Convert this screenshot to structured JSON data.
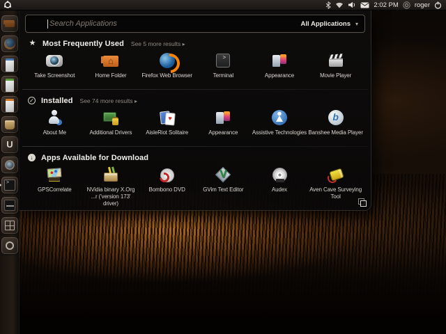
{
  "panel": {
    "logo_icon": "ubuntu-logo-icon",
    "time": "2:02 PM",
    "username": "roger",
    "indicator_icons": [
      "bluetooth-icon",
      "network-wifi-icon",
      "volume-icon",
      "mail-icon",
      "user-menu-icon",
      "power-icon"
    ]
  },
  "dash": {
    "search": {
      "value": "",
      "placeholder": "Search Applications",
      "filter_label": "All Applications",
      "filter_icon": "chevron-down-icon",
      "chevron_glyph": "▾"
    },
    "sections": [
      {
        "title": "Most Frequently Used",
        "icon": "star-icon",
        "icon_glyph": "★",
        "see_more": "See 5 more results",
        "see_more_arrow": "▸",
        "apps": [
          {
            "label": "Take Screenshot",
            "icon": "camera-icon"
          },
          {
            "label": "Home Folder",
            "icon": "home-folder-icon"
          },
          {
            "label": "Firefox Web Browser",
            "icon": "firefox-icon"
          },
          {
            "label": "Terminal",
            "icon": "terminal-icon"
          },
          {
            "label": "Appearance",
            "icon": "appearance-icon"
          },
          {
            "label": "Movie Player",
            "icon": "movie-clapper-icon"
          }
        ]
      },
      {
        "title": "Installed",
        "icon": "installed-check-icon",
        "icon_glyph": "✓",
        "see_more": "See 74 more results",
        "see_more_arrow": "▸",
        "apps": [
          {
            "label": "About Me",
            "icon": "about-me-icon"
          },
          {
            "label": "Additional Drivers",
            "icon": "drivers-board-icon"
          },
          {
            "label": "AisleRiot Solitaire",
            "icon": "solitaire-cards-icon"
          },
          {
            "label": "Appearance",
            "icon": "appearance-icon"
          },
          {
            "label": "Assistive Technologies",
            "icon": "accessibility-icon"
          },
          {
            "label": "Banshee Media Player",
            "icon": "banshee-icon"
          }
        ]
      },
      {
        "title": "Apps Available for Download",
        "icon": "download-circle-icon",
        "icon_glyph": "↓",
        "see_more": "",
        "see_more_arrow": "",
        "apps": [
          {
            "label": "GPSCorrelate",
            "icon": "gps-map-icon"
          },
          {
            "label": "NVidia binary X.Org\n...r ('version 173' driver)",
            "icon": "toolbox-icon"
          },
          {
            "label": "Bombono DVD",
            "icon": "dvd-disc-icon"
          },
          {
            "label": "GVim Text Editor",
            "icon": "gvim-icon"
          },
          {
            "label": "Audex",
            "icon": "cd-disc-icon"
          },
          {
            "label": "Aven Cave Surveying\nTool",
            "icon": "survey-device-icon"
          }
        ]
      }
    ],
    "expand_icon": "expand-window-icon"
  },
  "launcher": {
    "items": [
      {
        "name": "launcher-item-home-folder",
        "icon": "home-folder"
      },
      {
        "name": "launcher-item-firefox",
        "icon": "firefox"
      },
      {
        "name": "launcher-item-writer-document",
        "icon": "writer-document"
      },
      {
        "name": "launcher-item-calc-spreadsheet",
        "icon": "calc-spreadsheet"
      },
      {
        "name": "launcher-item-impress-presentation",
        "icon": "impress-presentation"
      },
      {
        "name": "launcher-item-software-center",
        "icon": "software-center-bag"
      },
      {
        "name": "launcher-item-ubuntu-one",
        "icon": "ubuntu-one"
      },
      {
        "name": "launcher-item-screenshot-camera",
        "icon": "screenshot-camera"
      },
      {
        "name": "launcher-item-terminal",
        "icon": "terminal",
        "running": true
      },
      {
        "name": "launcher-item-audio-app",
        "icon": "audio-app"
      },
      {
        "name": "launcher-item-workspace-switcher",
        "icon": "workspace-grid"
      },
      {
        "name": "launcher-item-applications-lens",
        "icon": "ring-lens"
      }
    ],
    "trash_icon": "trash-icon"
  },
  "colors": {
    "panel_bg": "#221d19",
    "dash_bg": "#0b0a09",
    "launcher_bg": "#1c1510",
    "wallpaper_glow": "#eb8c26",
    "text_primary": "#f2f0ec",
    "text_secondary": "#8f8a82",
    "folder_orange": "#d97a2b"
  }
}
